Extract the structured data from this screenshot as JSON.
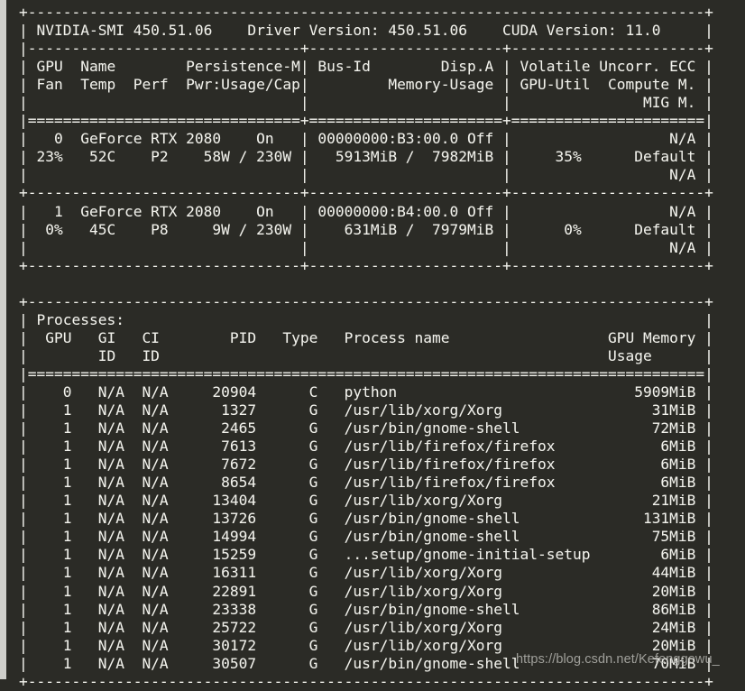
{
  "terminal": {
    "background_color": "#2b2b26",
    "text_color": "#f2f2ec",
    "command_output_name": "nvidia-smi"
  },
  "header": {
    "smi_label": "NVIDIA-SMI",
    "smi_version": "450.51.06",
    "driver_label": "Driver Version:",
    "driver_version": "450.51.06",
    "cuda_label": "CUDA Version:",
    "cuda_version": "11.0"
  },
  "gpu_table": {
    "columns_line1": [
      "GPU",
      "Name",
      "Persistence-M",
      "Bus-Id",
      "Disp.A",
      "Volatile Uncorr. ECC"
    ],
    "columns_line2": [
      "Fan",
      "Temp",
      "Perf",
      "Pwr:Usage/Cap",
      "Memory-Usage",
      "GPU-Util",
      "Compute M."
    ],
    "columns_line3": [
      "MIG M."
    ],
    "rows": [
      {
        "gpu": "0",
        "name": "GeForce RTX 2080",
        "persistence_m": "On",
        "bus_id": "00000000:B3:00.0",
        "disp_a": "Off",
        "ecc": "N/A",
        "fan": "23%",
        "temp": "52C",
        "perf": "P2",
        "pwr_usage": "58W",
        "pwr_cap": "230W",
        "mem_used": "5913MiB",
        "mem_total": "7982MiB",
        "gpu_util": "35%",
        "compute_m": "Default",
        "mig_m": "N/A"
      },
      {
        "gpu": "1",
        "name": "GeForce RTX 2080",
        "persistence_m": "On",
        "bus_id": "00000000:B4:00.0",
        "disp_a": "Off",
        "ecc": "N/A",
        "fan": "0%",
        "temp": "45C",
        "perf": "P8",
        "pwr_usage": "9W",
        "pwr_cap": "230W",
        "mem_used": "631MiB",
        "mem_total": "7979MiB",
        "gpu_util": "0%",
        "compute_m": "Default",
        "mig_m": "N/A"
      }
    ]
  },
  "processes_table": {
    "title": "Processes:",
    "columns_line1": [
      "GPU",
      "GI",
      "CI",
      "PID",
      "Type",
      "Process name",
      "GPU Memory"
    ],
    "columns_line2": [
      "ID",
      "ID",
      "Usage"
    ],
    "rows": [
      {
        "gpu": "0",
        "gi_id": "N/A",
        "ci_id": "N/A",
        "pid": "20904",
        "type": "C",
        "process_name": "python",
        "gpu_memory_usage": "5909MiB"
      },
      {
        "gpu": "1",
        "gi_id": "N/A",
        "ci_id": "N/A",
        "pid": "1327",
        "type": "G",
        "process_name": "/usr/lib/xorg/Xorg",
        "gpu_memory_usage": "31MiB"
      },
      {
        "gpu": "1",
        "gi_id": "N/A",
        "ci_id": "N/A",
        "pid": "2465",
        "type": "G",
        "process_name": "/usr/bin/gnome-shell",
        "gpu_memory_usage": "72MiB"
      },
      {
        "gpu": "1",
        "gi_id": "N/A",
        "ci_id": "N/A",
        "pid": "7613",
        "type": "G",
        "process_name": "/usr/lib/firefox/firefox",
        "gpu_memory_usage": "6MiB"
      },
      {
        "gpu": "1",
        "gi_id": "N/A",
        "ci_id": "N/A",
        "pid": "7672",
        "type": "G",
        "process_name": "/usr/lib/firefox/firefox",
        "gpu_memory_usage": "6MiB"
      },
      {
        "gpu": "1",
        "gi_id": "N/A",
        "ci_id": "N/A",
        "pid": "8654",
        "type": "G",
        "process_name": "/usr/lib/firefox/firefox",
        "gpu_memory_usage": "6MiB"
      },
      {
        "gpu": "1",
        "gi_id": "N/A",
        "ci_id": "N/A",
        "pid": "13404",
        "type": "G",
        "process_name": "/usr/lib/xorg/Xorg",
        "gpu_memory_usage": "21MiB"
      },
      {
        "gpu": "1",
        "gi_id": "N/A",
        "ci_id": "N/A",
        "pid": "13726",
        "type": "G",
        "process_name": "/usr/bin/gnome-shell",
        "gpu_memory_usage": "131MiB"
      },
      {
        "gpu": "1",
        "gi_id": "N/A",
        "ci_id": "N/A",
        "pid": "14994",
        "type": "G",
        "process_name": "/usr/bin/gnome-shell",
        "gpu_memory_usage": "75MiB"
      },
      {
        "gpu": "1",
        "gi_id": "N/A",
        "ci_id": "N/A",
        "pid": "15259",
        "type": "G",
        "process_name": "...setup/gnome-initial-setup",
        "gpu_memory_usage": "6MiB"
      },
      {
        "gpu": "1",
        "gi_id": "N/A",
        "ci_id": "N/A",
        "pid": "16311",
        "type": "G",
        "process_name": "/usr/lib/xorg/Xorg",
        "gpu_memory_usage": "44MiB"
      },
      {
        "gpu": "1",
        "gi_id": "N/A",
        "ci_id": "N/A",
        "pid": "22891",
        "type": "G",
        "process_name": "/usr/lib/xorg/Xorg",
        "gpu_memory_usage": "20MiB"
      },
      {
        "gpu": "1",
        "gi_id": "N/A",
        "ci_id": "N/A",
        "pid": "23338",
        "type": "G",
        "process_name": "/usr/bin/gnome-shell",
        "gpu_memory_usage": "86MiB"
      },
      {
        "gpu": "1",
        "gi_id": "N/A",
        "ci_id": "N/A",
        "pid": "25722",
        "type": "G",
        "process_name": "/usr/lib/xorg/Xorg",
        "gpu_memory_usage": "24MiB"
      },
      {
        "gpu": "1",
        "gi_id": "N/A",
        "ci_id": "N/A",
        "pid": "30172",
        "type": "G",
        "process_name": "/usr/lib/xorg/Xorg",
        "gpu_memory_usage": "20MiB"
      },
      {
        "gpu": "1",
        "gi_id": "N/A",
        "ci_id": "N/A",
        "pid": "30507",
        "type": "G",
        "process_name": "/usr/bin/gnome-shell",
        "gpu_memory_usage": "70MiB"
      }
    ]
  },
  "watermark": {
    "text": "https://blog.csdn.net/Kefenggewu_"
  },
  "raw_output": "+-----------------------------------------------------------------------------+\n| NVIDIA-SMI 450.51.06    Driver Version: 450.51.06    CUDA Version: 11.0     |\n|-------------------------------+----------------------+----------------------+\n| GPU  Name        Persistence-M| Bus-Id        Disp.A | Volatile Uncorr. ECC |\n| Fan  Temp  Perf  Pwr:Usage/Cap|         Memory-Usage | GPU-Util  Compute M. |\n|                               |                      |               MIG M. |\n|===============================+======================+======================|\n|   0  GeForce RTX 2080    On   | 00000000:B3:00.0 Off |                  N/A |\n| 23%   52C    P2    58W / 230W |   5913MiB /  7982MiB |     35%      Default |\n|                               |                      |                  N/A |\n+-------------------------------+----------------------+----------------------+\n|   1  GeForce RTX 2080    On   | 00000000:B4:00.0 Off |                  N/A |\n|  0%   45C    P8     9W / 230W |    631MiB /  7979MiB |      0%      Default |\n|                               |                      |                  N/A |\n+-------------------------------+----------------------+----------------------+\n                                                                               \n+-----------------------------------------------------------------------------+\n| Processes:                                                                  |\n|  GPU   GI   CI        PID   Type   Process name                  GPU Memory |\n|        ID   ID                                                   Usage      |\n|=============================================================================|\n|    0   N/A  N/A     20904      C   python                           5909MiB |\n|    1   N/A  N/A      1327      G   /usr/lib/xorg/Xorg                 31MiB |\n|    1   N/A  N/A      2465      G   /usr/bin/gnome-shell               72MiB |\n|    1   N/A  N/A      7613      G   /usr/lib/firefox/firefox            6MiB |\n|    1   N/A  N/A      7672      G   /usr/lib/firefox/firefox            6MiB |\n|    1   N/A  N/A      8654      G   /usr/lib/firefox/firefox            6MiB |\n|    1   N/A  N/A     13404      G   /usr/lib/xorg/Xorg                 21MiB |\n|    1   N/A  N/A     13726      G   /usr/bin/gnome-shell              131MiB |\n|    1   N/A  N/A     14994      G   /usr/bin/gnome-shell               75MiB |\n|    1   N/A  N/A     15259      G   ...setup/gnome-initial-setup        6MiB |\n|    1   N/A  N/A     16311      G   /usr/lib/xorg/Xorg                 44MiB |\n|    1   N/A  N/A     22891      G   /usr/lib/xorg/Xorg                 20MiB |\n|    1   N/A  N/A     23338      G   /usr/bin/gnome-shell               86MiB |\n|    1   N/A  N/A     25722      G   /usr/lib/xorg/Xorg                 24MiB |\n|    1   N/A  N/A     30172      G   /usr/lib/xorg/Xorg                 20MiB |\n|    1   N/A  N/A     30507      G   /usr/bin/gnome-shell               70MiB |\n+-----------------------------------------------------------------------------+"
}
